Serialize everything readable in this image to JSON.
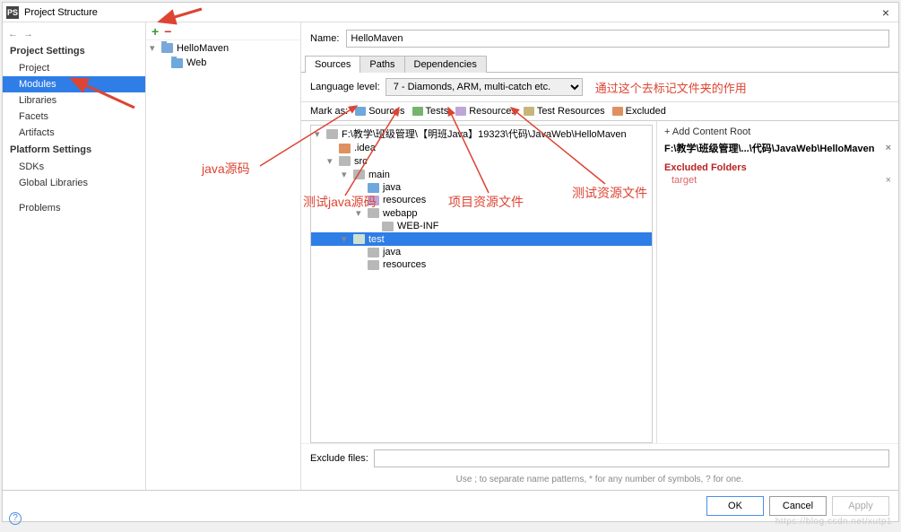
{
  "window": {
    "title": "Project Structure"
  },
  "sidebar": {
    "sections": [
      {
        "header": "Project Settings",
        "items": [
          "Project",
          "Modules",
          "Libraries",
          "Facets",
          "Artifacts"
        ],
        "selected": "Modules"
      },
      {
        "header": "Platform Settings",
        "items": [
          "SDKs",
          "Global Libraries"
        ]
      },
      {
        "header": "",
        "items": [
          "Problems"
        ]
      }
    ]
  },
  "moduleTree": {
    "root": "HelloMaven",
    "children": [
      "Web"
    ]
  },
  "name": {
    "label": "Name:",
    "value": "HelloMaven"
  },
  "tabs": {
    "items": [
      "Sources",
      "Paths",
      "Dependencies"
    ],
    "active": "Sources"
  },
  "langLevel": {
    "label": "Language level:",
    "value": "7 - Diamonds, ARM, multi-catch etc."
  },
  "markAs": {
    "label": "Mark as:",
    "buttons": [
      {
        "key": "sources",
        "label": "Sources",
        "swatch": "sw-src"
      },
      {
        "key": "tests",
        "label": "Tests",
        "swatch": "sw-test"
      },
      {
        "key": "resources",
        "label": "Resources",
        "swatch": "sw-res"
      },
      {
        "key": "test-resources",
        "label": "Test Resources",
        "swatch": "sw-tres"
      },
      {
        "key": "excluded",
        "label": "Excluded",
        "swatch": "sw-exc"
      }
    ]
  },
  "folderTree": {
    "rows": [
      {
        "indent": 0,
        "caret": "▾",
        "cls": "folder-g",
        "text": "F:\\教学\\班级管理\\【明班Java】19323\\代码\\JavaWeb\\HelloMaven"
      },
      {
        "indent": 1,
        "caret": "",
        "cls": "folder-ex",
        "text": ".idea"
      },
      {
        "indent": 1,
        "caret": "▾",
        "cls": "folder-g",
        "text": "src"
      },
      {
        "indent": 2,
        "caret": "▾",
        "cls": "folder-g",
        "text": "main"
      },
      {
        "indent": 3,
        "caret": "",
        "cls": "folder-blue",
        "text": "java"
      },
      {
        "indent": 3,
        "caret": "",
        "cls": "folder-res",
        "text": "resources"
      },
      {
        "indent": 3,
        "caret": "▾",
        "cls": "folder-g",
        "text": "webapp"
      },
      {
        "indent": 4,
        "caret": "",
        "cls": "folder-g",
        "text": "WEB-INF"
      },
      {
        "indent": 2,
        "caret": "▾",
        "cls": "folder-green",
        "text": "test",
        "selected": true
      },
      {
        "indent": 3,
        "caret": "",
        "cls": "folder-g",
        "text": "java"
      },
      {
        "indent": 3,
        "caret": "",
        "cls": "folder-g",
        "text": "resources"
      }
    ]
  },
  "contentRoot": {
    "addLabel": "+ Add Content Root",
    "path": "F:\\教学\\班级管理\\...\\代码\\JavaWeb\\HelloMaven",
    "excludedHeader": "Excluded Folders",
    "excludedItems": [
      "target"
    ]
  },
  "excludeFiles": {
    "label": "Exclude files:",
    "value": "",
    "hint": "Use ; to separate name patterns, * for any number of symbols, ? for one."
  },
  "footer": {
    "ok": "OK",
    "cancel": "Cancel",
    "apply": "Apply"
  },
  "annotations": {
    "lang": "通过这个去标记文件夹的作用",
    "src": "java源码",
    "testsrc": "测试java源码",
    "res": "项目资源文件",
    "tres": "测试资源文件"
  },
  "watermark": "https://blog.csdn.net/xutp1"
}
